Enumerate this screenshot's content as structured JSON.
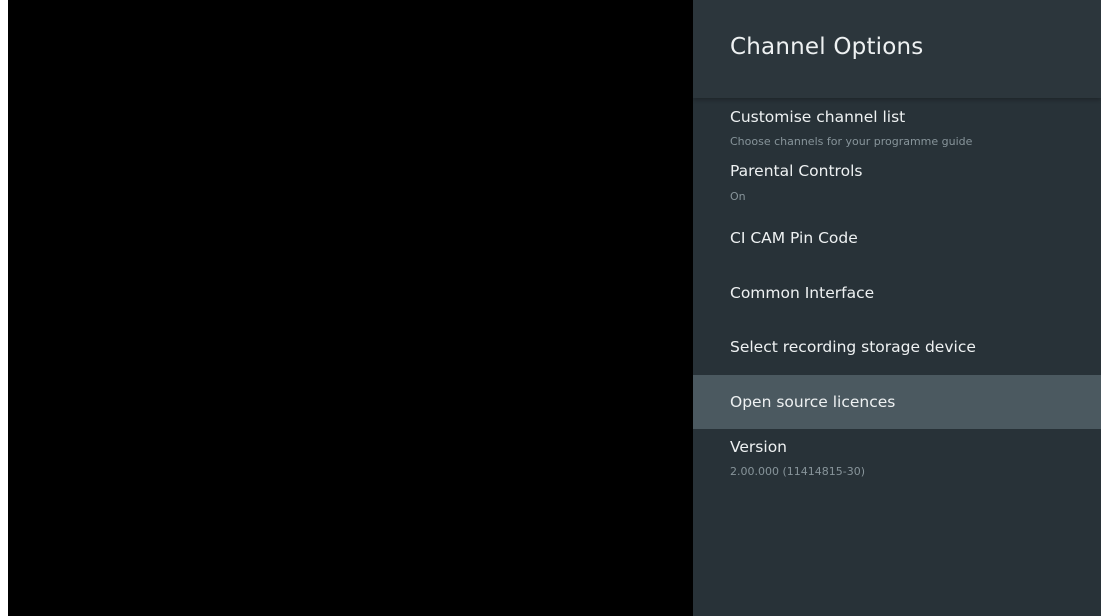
{
  "panel": {
    "title": "Channel Options",
    "items": [
      {
        "label": "Customise channel list",
        "subtitle": "Choose channels for your programme guide"
      },
      {
        "label": "Parental Controls",
        "subtitle": "On"
      },
      {
        "label": "CI CAM Pin Code",
        "subtitle": ""
      },
      {
        "label": "Common Interface",
        "subtitle": ""
      },
      {
        "label": "Select recording storage device",
        "subtitle": ""
      },
      {
        "label": "Open source licences",
        "subtitle": "",
        "selected": true
      },
      {
        "label": "Version",
        "subtitle": "2.00.000 (11414815-30)"
      }
    ]
  },
  "colors": {
    "background": "#000000",
    "panel": "#283238",
    "header": "#2c363c",
    "selected_row": "#4b5960",
    "primary_text": "#eef1f2",
    "secondary_text": "#87949a"
  }
}
